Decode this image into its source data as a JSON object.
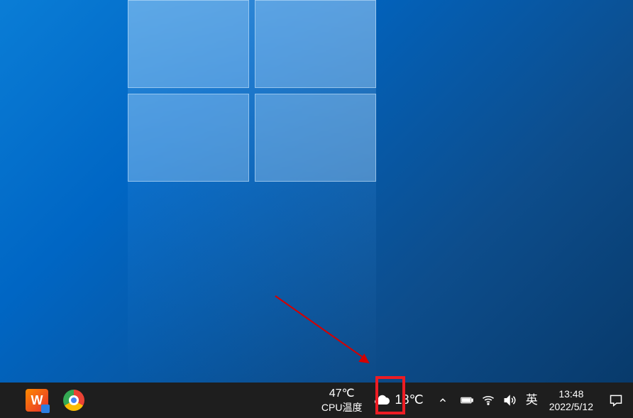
{
  "taskbar": {
    "pinned": [
      {
        "name": "wps",
        "glyph": "W"
      },
      {
        "name": "chrome"
      }
    ],
    "cpu_temp": {
      "value": "47℃",
      "label": "CPU温度"
    },
    "weather": {
      "temp": "18℃"
    },
    "ime": "英",
    "clock": {
      "time": "13:48",
      "date": "2022/5/12"
    }
  },
  "annotation": {
    "highlight_target": "show-hidden-icons"
  }
}
